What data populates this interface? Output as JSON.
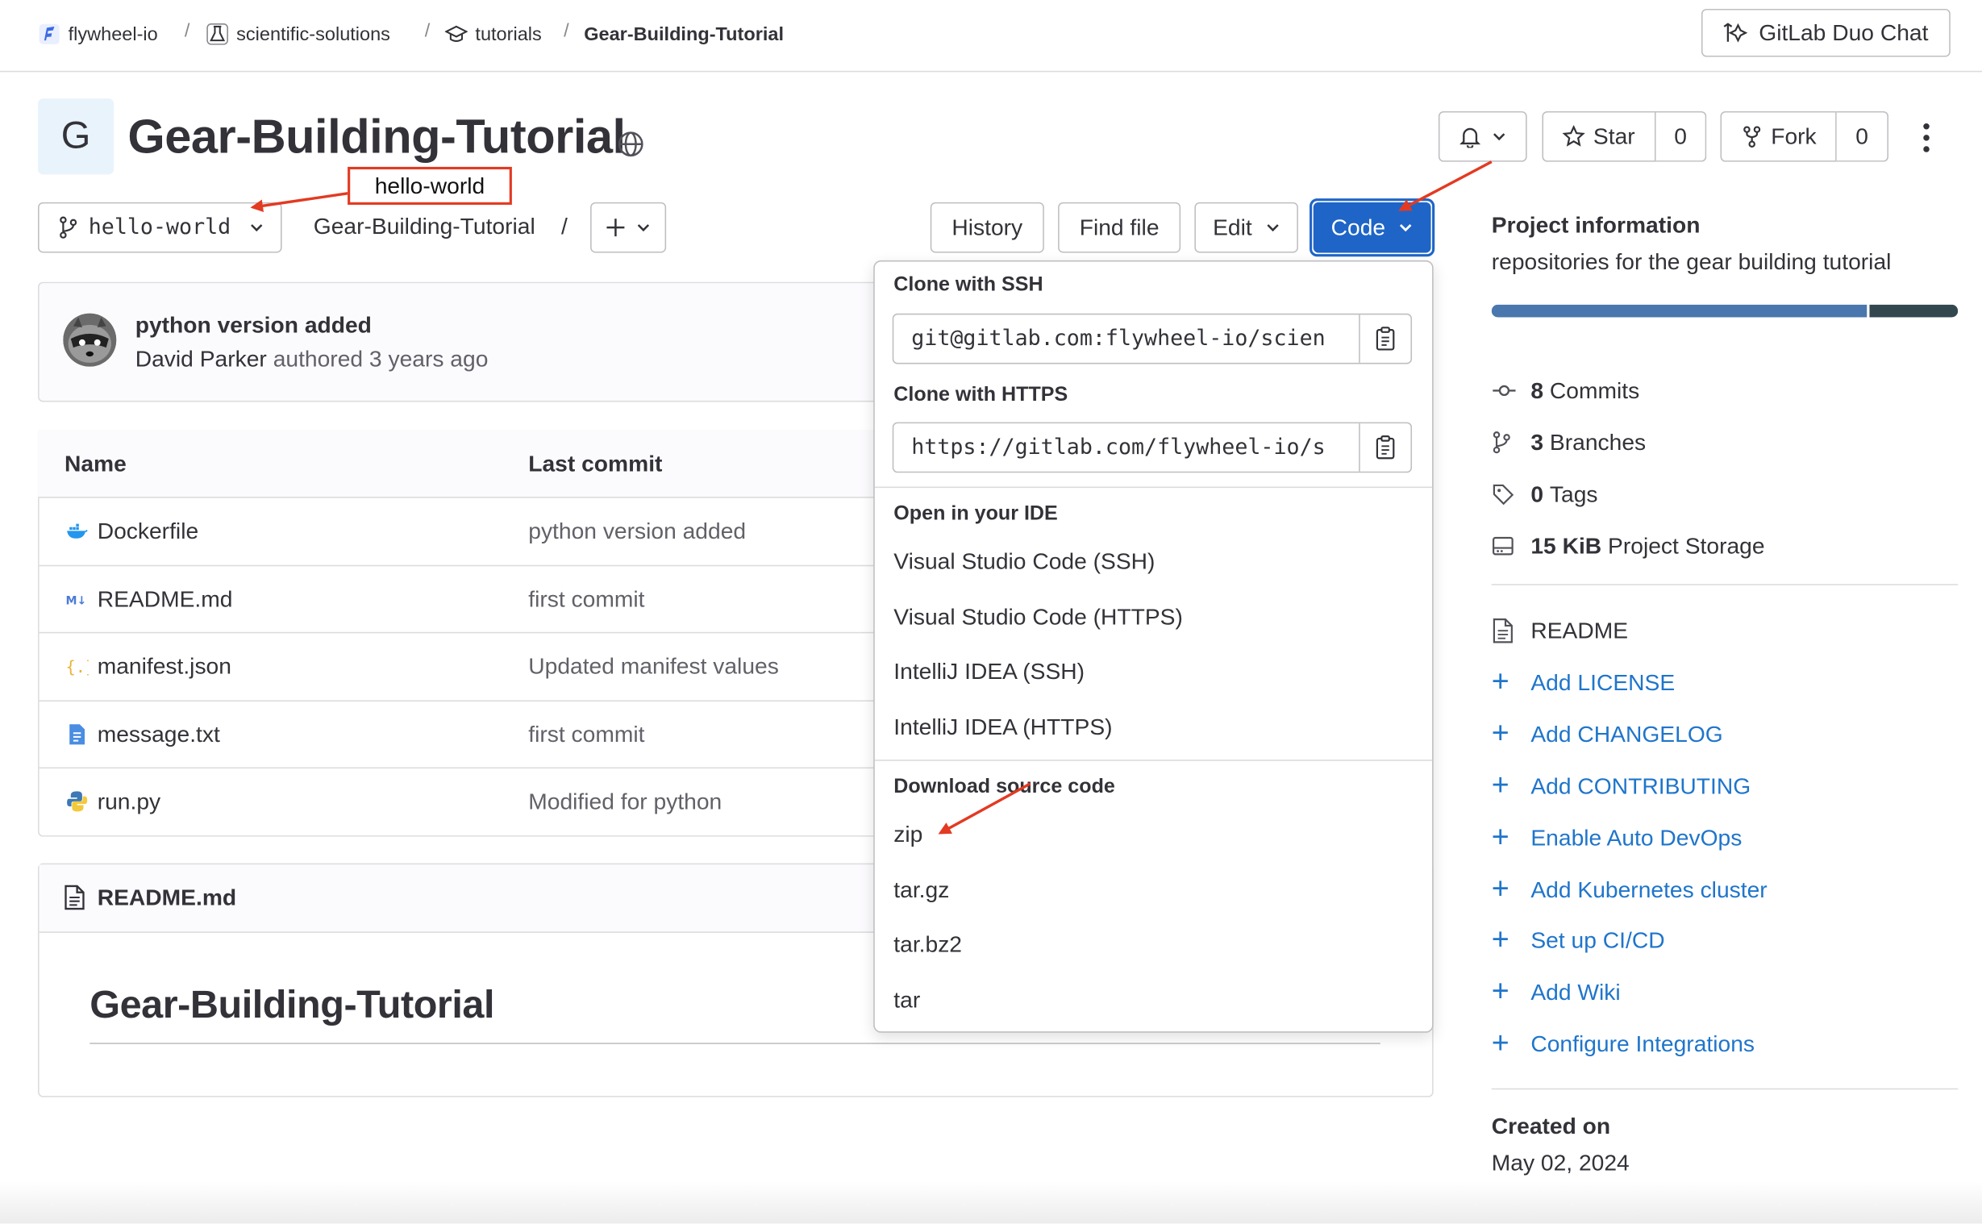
{
  "breadcrumb": {
    "items": [
      "flywheel-io",
      "scientific-solutions",
      "tutorials",
      "Gear-Building-Tutorial"
    ],
    "separator": "/"
  },
  "duo_chat": {
    "label": "GitLab Duo Chat"
  },
  "project": {
    "avatar_letter": "G",
    "title": "Gear-Building-Tutorial"
  },
  "actions": {
    "star_label": "Star",
    "star_count": "0",
    "fork_label": "Fork",
    "fork_count": "0"
  },
  "annotation": {
    "label": "hello-world"
  },
  "branch": {
    "name": "hello-world"
  },
  "path": {
    "repo": "Gear-Building-Tutorial",
    "slash": "/"
  },
  "toolbar": {
    "history": "History",
    "find_file": "Find file",
    "edit": "Edit",
    "code": "Code"
  },
  "last_commit": {
    "title": "python version added",
    "author": "David Parker",
    "meta": "authored 3 years ago"
  },
  "files": {
    "headers": {
      "name": "Name",
      "last_commit": "Last commit"
    },
    "rows": [
      {
        "name": "Dockerfile",
        "commit": "python version added",
        "icon": "docker-icon"
      },
      {
        "name": "README.md",
        "commit": "first commit",
        "icon": "markdown-icon"
      },
      {
        "name": "manifest.json",
        "commit": "Updated manifest values",
        "icon": "json-icon"
      },
      {
        "name": "message.txt",
        "commit": "first commit",
        "icon": "text-file-icon"
      },
      {
        "name": "run.py",
        "commit": "Modified for python",
        "icon": "python-icon"
      }
    ]
  },
  "readme": {
    "file_label": "README.md",
    "heading": "Gear-Building-Tutorial"
  },
  "code_dropdown": {
    "clone_ssh_label": "Clone with SSH",
    "clone_ssh_value": "git@gitlab.com:flywheel-io/scien",
    "clone_https_label": "Clone with HTTPS",
    "clone_https_value": "https://gitlab.com/flywheel-io/s",
    "ide_header": "Open in your IDE",
    "ide_items": [
      "Visual Studio Code (SSH)",
      "Visual Studio Code (HTTPS)",
      "IntelliJ IDEA (SSH)",
      "IntelliJ IDEA (HTTPS)"
    ],
    "download_header": "Download source code",
    "download_items": [
      "zip",
      "tar.gz",
      "tar.bz2",
      "tar"
    ]
  },
  "sidebar": {
    "info_title": "Project information",
    "description": "repositories for the gear building tutorial",
    "stats": [
      {
        "count": "8",
        "label": "Commits",
        "icon": "commit-icon"
      },
      {
        "count": "3",
        "label": "Branches",
        "icon": "branch-icon"
      },
      {
        "count": "0",
        "label": "Tags",
        "icon": "tag-icon"
      },
      {
        "count": "15 KiB",
        "label": "Project Storage",
        "icon": "storage-icon"
      }
    ],
    "readme_label": "README",
    "links": [
      "Add LICENSE",
      "Add CHANGELOG",
      "Add CONTRIBUTING",
      "Enable Auto DevOps",
      "Add Kubernetes cluster",
      "Set up CI/CD",
      "Add Wiki",
      "Configure Integrations"
    ],
    "created_label": "Created on",
    "created_date": "May 02, 2024"
  },
  "colors": {
    "accent_blue": "#1f75cb",
    "code_button": "#1f65c7",
    "annotation_red": "#e33a22",
    "language_bar_primary": "#4a77ad",
    "language_bar_secondary": "#33474f"
  }
}
